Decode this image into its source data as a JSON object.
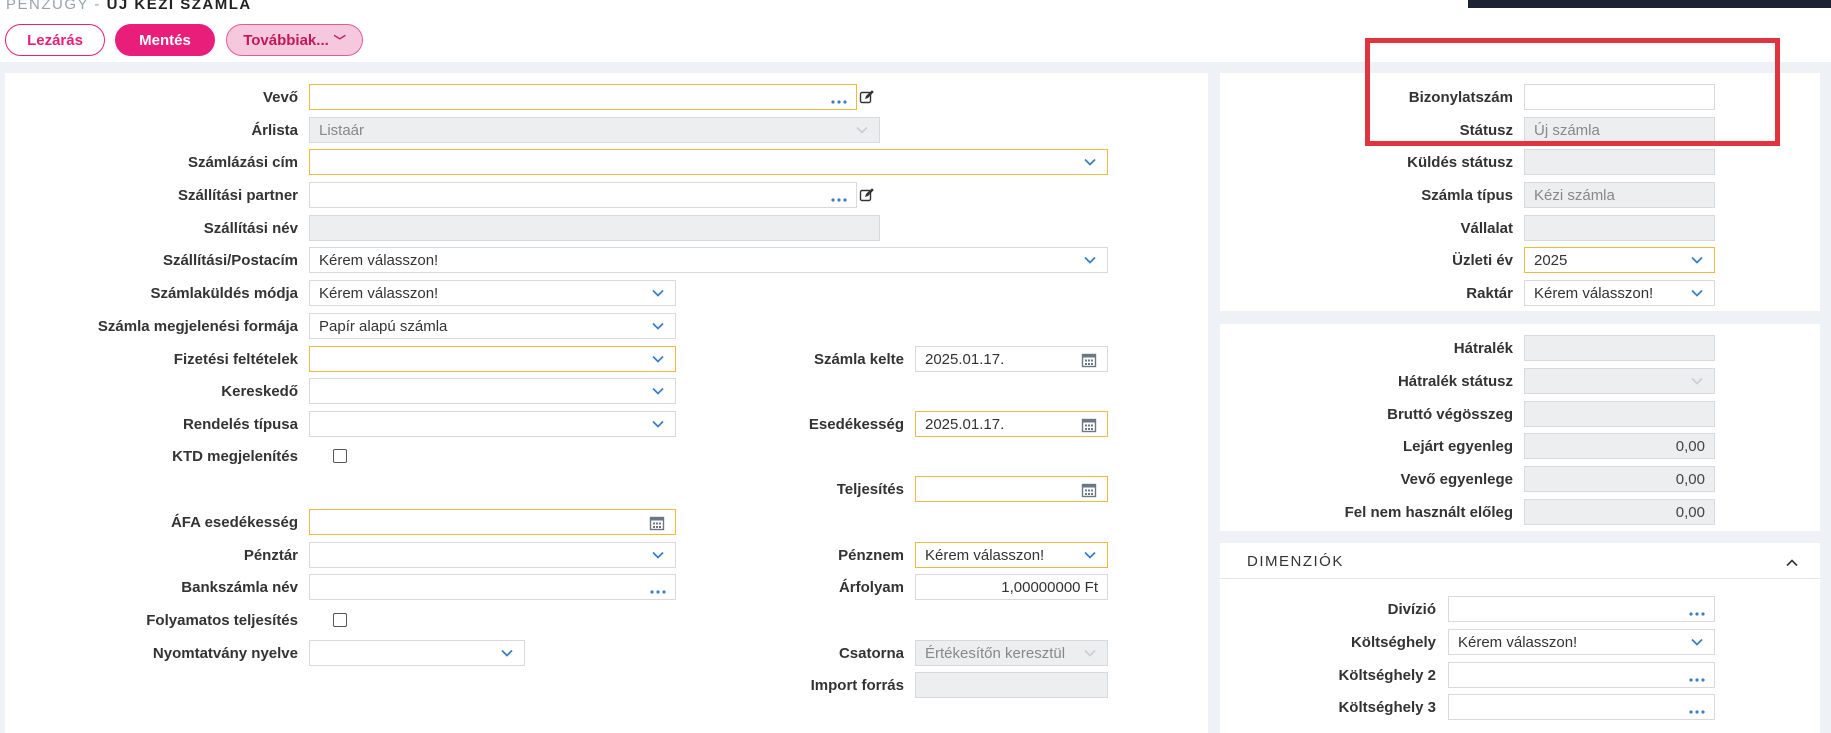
{
  "breadcrumb": {
    "module": "PÉNZÜGY -",
    "current": "ÚJ KÉZI SZÁMLA"
  },
  "toolbar": {
    "close_label": "Lezárás",
    "save_label": "Mentés",
    "more_label": "Továbbiak..."
  },
  "form": {
    "buyer": {
      "label": "Vevő",
      "value": ""
    },
    "price_list": {
      "label": "Árlista",
      "value": "Listaár"
    },
    "billing_address": {
      "label": "Számlázási cím",
      "value": ""
    },
    "shipping_partner": {
      "label": "Szállítási partner",
      "value": ""
    },
    "shipping_name": {
      "label": "Szállítási név",
      "value": ""
    },
    "shipping_postal_address": {
      "label": "Szállítási/Postacím",
      "value": "Kérem válasszon!"
    },
    "invoice_send_mode": {
      "label": "Számlaküldés módja",
      "value": "Kérem válasszon!"
    },
    "invoice_display_form": {
      "label": "Számla megjelenési formája",
      "value": "Papír alapú számla"
    },
    "payment_terms": {
      "label": "Fizetési feltételek",
      "value": ""
    },
    "salesperson": {
      "label": "Kereskedő",
      "value": ""
    },
    "order_type": {
      "label": "Rendelés típusa",
      "value": ""
    },
    "ktd_display": {
      "label": "KTD megjelenítés",
      "checked": false
    },
    "vat_due": {
      "label": "ÁFA esedékesség",
      "value": ""
    },
    "cash_register": {
      "label": "Pénztár",
      "value": ""
    },
    "bank_account_name": {
      "label": "Bankszámla név",
      "value": ""
    },
    "continuous_fulfillment": {
      "label": "Folyamatos teljesítés",
      "checked": false
    },
    "print_language": {
      "label": "Nyomtatvány nyelve",
      "value": ""
    },
    "invoice_date": {
      "label": "Számla kelte",
      "value": "2025.01.17."
    },
    "due_date": {
      "label": "Esedékesség",
      "value": "2025.01.17."
    },
    "fulfillment": {
      "label": "Teljesítés",
      "value": ""
    },
    "currency": {
      "label": "Pénznem",
      "value": "Kérem válasszon!"
    },
    "exchange_rate": {
      "label": "Árfolyam",
      "value": "1,00000000 Ft"
    },
    "channel": {
      "label": "Csatorna",
      "value": "Értékesítőn keresztül"
    },
    "import_source": {
      "label": "Import forrás",
      "value": ""
    }
  },
  "side": {
    "document_number": {
      "label": "Bizonylatszám",
      "value": ""
    },
    "status": {
      "label": "Státusz",
      "value": "Új számla"
    },
    "send_status": {
      "label": "Küldés státusz",
      "value": ""
    },
    "invoice_type": {
      "label": "Számla típus",
      "value": "Kézi számla"
    },
    "company": {
      "label": "Vállalat",
      "value": ""
    },
    "fiscal_year": {
      "label": "Üzleti év",
      "value": "2025"
    },
    "warehouse": {
      "label": "Raktár",
      "value": "Kérem válasszon!"
    },
    "arrears": {
      "label": "Hátralék",
      "value": ""
    },
    "arrears_status": {
      "label": "Hátralék státusz",
      "value": ""
    },
    "gross_total": {
      "label": "Bruttó végösszeg",
      "value": ""
    },
    "overdue_balance": {
      "label": "Lejárt egyenleg",
      "value": "0,00"
    },
    "buyer_balance": {
      "label": "Vevő egyenlege",
      "value": "0,00"
    },
    "unused_advance": {
      "label": "Fel nem használt előleg",
      "value": "0,00"
    }
  },
  "dimensions": {
    "title": "DIMENZIÓK",
    "division": {
      "label": "Divízió",
      "value": ""
    },
    "cost_center": {
      "label": "Költséghely",
      "value": "Kérem válasszon!"
    },
    "cost_center_2": {
      "label": "Költséghely 2",
      "value": ""
    },
    "cost_center_3": {
      "label": "Költséghely 3",
      "value": ""
    }
  },
  "colors": {
    "accent": "#e91e7b",
    "required_border": "#f0b83c",
    "highlight": "#e0353f",
    "icon": "#3b7fc4"
  }
}
